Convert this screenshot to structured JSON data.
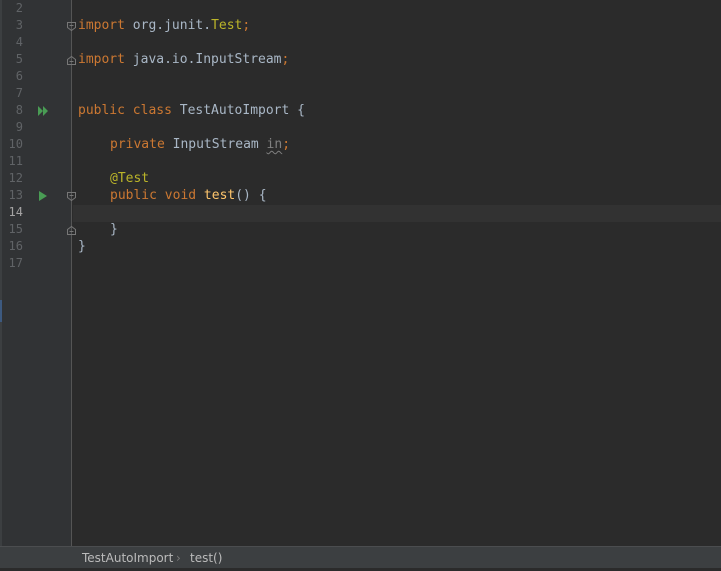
{
  "editor": {
    "current_line": "14",
    "line_numbers": [
      "2",
      "3",
      "4",
      "5",
      "6",
      "7",
      "8",
      "9",
      "10",
      "11",
      "12",
      "13",
      "14",
      "15",
      "16",
      "17"
    ],
    "code": {
      "l3": {
        "kw": "import",
        "pkg": " org.junit.",
        "cls": "Test",
        "semi": ";"
      },
      "l5": {
        "kw": "import",
        "pkg": " java.io.InputStream",
        "semi": ";"
      },
      "l8": {
        "kw": "public class",
        "name": " TestAutoImport {"
      },
      "l10": {
        "kw": "private",
        "type": " InputStream ",
        "field": "in",
        "semi": ";"
      },
      "l12": {
        "ann": "@Test"
      },
      "l13": {
        "kw": "public void",
        "fn": "test",
        "rest": "() {"
      },
      "l15": {
        "text": "}"
      },
      "l16": {
        "text": "}"
      }
    },
    "gutter_icons": {
      "class_run": "run-all-icon",
      "method_run": "run-icon",
      "fold": "fold-icon"
    }
  },
  "breadcrumb": {
    "items": [
      "TestAutoImport",
      "test()"
    ],
    "separator": "›"
  },
  "colors": {
    "background": "#2b2b2b",
    "gutter": "#313335",
    "keyword": "#cc7832",
    "annotation": "#bbb529",
    "function": "#ffc66d",
    "text": "#a9b7c6",
    "run_green": "#499c54"
  }
}
